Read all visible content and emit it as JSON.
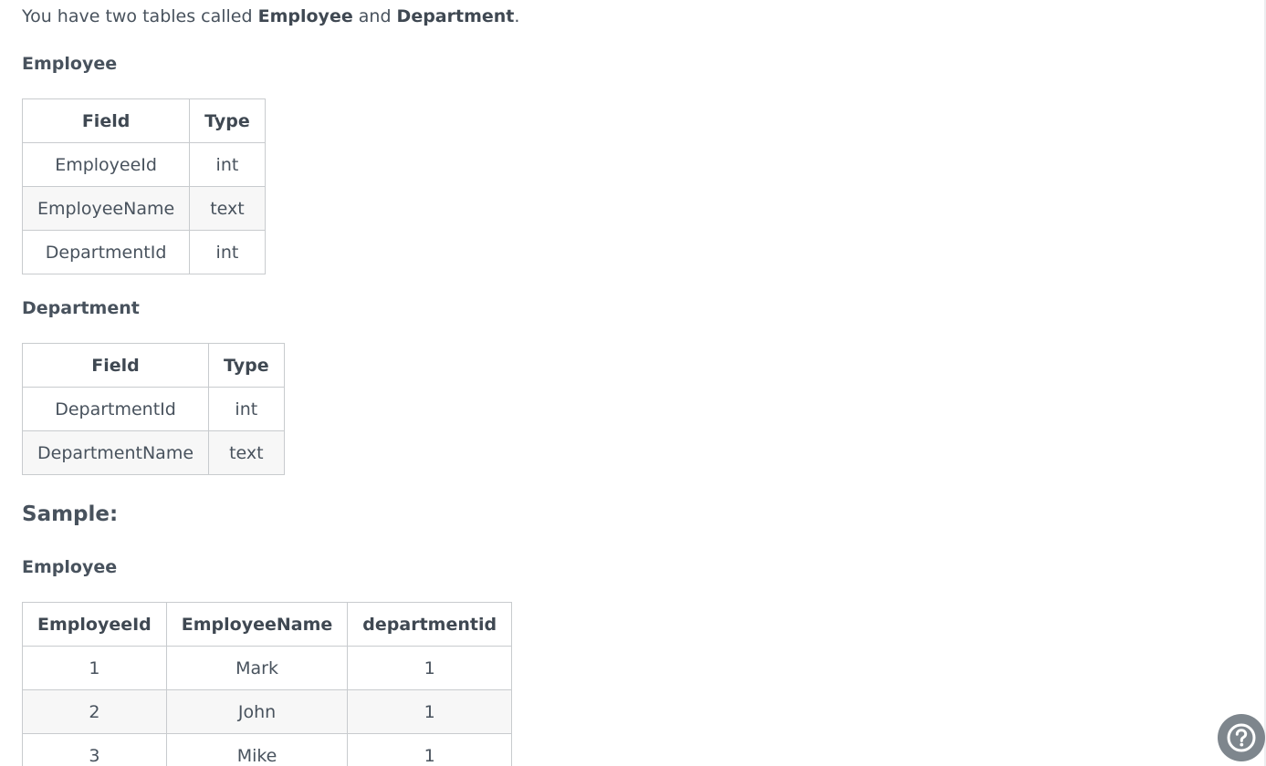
{
  "intro": {
    "prefix": "You have two tables called ",
    "table1": "Employee",
    "middle": " and ",
    "table2": "Department",
    "suffix": "."
  },
  "schema_tables": [
    {
      "title": "Employee",
      "headers": [
        "Field",
        "Type"
      ],
      "rows": [
        [
          "EmployeeId",
          "int"
        ],
        [
          "EmployeeName",
          "text"
        ],
        [
          "DepartmentId",
          "int"
        ]
      ]
    },
    {
      "title": "Department",
      "headers": [
        "Field",
        "Type"
      ],
      "rows": [
        [
          "DepartmentId",
          "int"
        ],
        [
          "DepartmentName",
          "text"
        ]
      ]
    }
  ],
  "sample": {
    "heading": "Sample:",
    "table": {
      "title": "Employee",
      "headers": [
        "EmployeeId",
        "EmployeeName",
        "departmentid"
      ],
      "rows": [
        [
          "1",
          "Mark",
          "1"
        ],
        [
          "2",
          "John",
          "1"
        ],
        [
          "3",
          "Mike",
          "1"
        ]
      ]
    }
  },
  "help_button": {
    "icon": "question-circle-icon",
    "color": "#7e868d"
  }
}
